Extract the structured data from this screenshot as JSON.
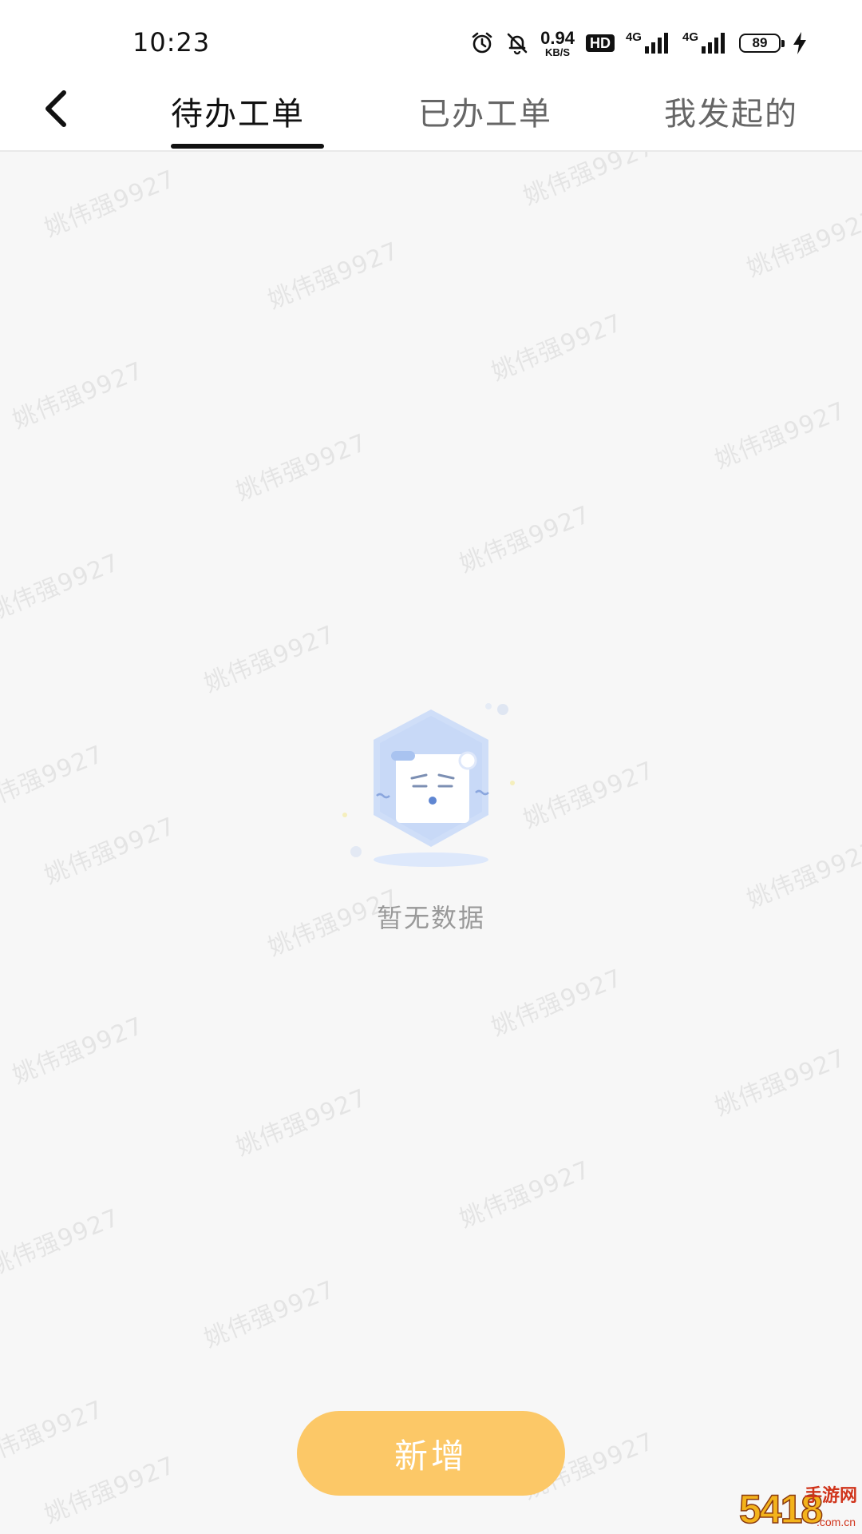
{
  "status_bar": {
    "time": "10:23",
    "network_speed_value": "0.94",
    "network_speed_unit": "KB/S",
    "hd_badge": "HD",
    "signal1_label": "4G",
    "signal2_label": "4G",
    "battery_level": "89"
  },
  "header": {
    "tabs": [
      {
        "label": "待办工单",
        "active": true
      },
      {
        "label": "已办工单",
        "active": false
      },
      {
        "label": "我发起的",
        "active": false
      }
    ]
  },
  "watermark_text": "姚伟强9927",
  "empty_state": {
    "text": "暂无数据"
  },
  "actions": {
    "add_label": "新增"
  },
  "corner_logo": {
    "big": "5418",
    "line1": "手游网",
    "line2": ".com.cn"
  },
  "colors": {
    "accent": "#fcc867",
    "background": "#f7f7f7",
    "illustration_blue": "#c8daf8"
  }
}
